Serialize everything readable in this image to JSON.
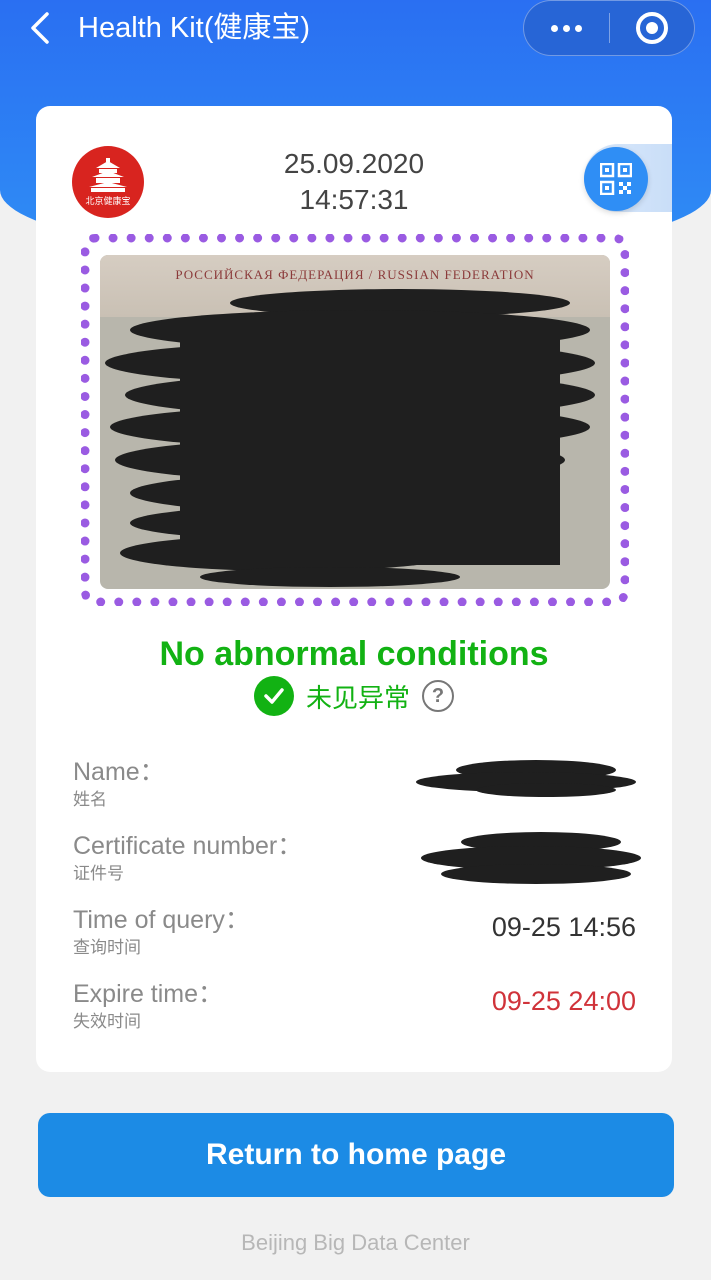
{
  "nav": {
    "title": "Health Kit(健康宝)"
  },
  "logo": {
    "text": "北京健康宝"
  },
  "card": {
    "date": "25.09.2020",
    "time": "14:57:31",
    "passport_header": "РОССИЙСКАЯ ФЕДЕРАЦИЯ / RUSSIAN FEDERATION",
    "passport_mrz": "<<<<<<<<<<<"
  },
  "status": {
    "english": "No abnormal conditions",
    "chinese": "未见异常",
    "color": "#12b213"
  },
  "info": [
    {
      "label": "Name：",
      "sub": "姓名",
      "value": ""
    },
    {
      "label": "Certificate  number：",
      "sub": "证件号",
      "value": ""
    },
    {
      "label": "Time of query：",
      "sub": "查询时间",
      "value": "09-25 14:56"
    },
    {
      "label": "Expire time：",
      "sub": "失效时间",
      "value": "09-25 24:00"
    }
  ],
  "button": {
    "label": "Return to home page"
  },
  "footer": {
    "text": "Beijing Big Data Center"
  },
  "icons": {
    "back": "chevron-left-icon",
    "more": "more-dots-icon",
    "close": "target-icon",
    "qr": "qr-code-icon",
    "check": "check-circle-icon",
    "help": "question-circle-icon"
  },
  "colors": {
    "header_blue": "#2a6ff2",
    "button_blue": "#1c8be5",
    "frame_purple": "#9a5be2",
    "expire_red": "#d0333a"
  }
}
